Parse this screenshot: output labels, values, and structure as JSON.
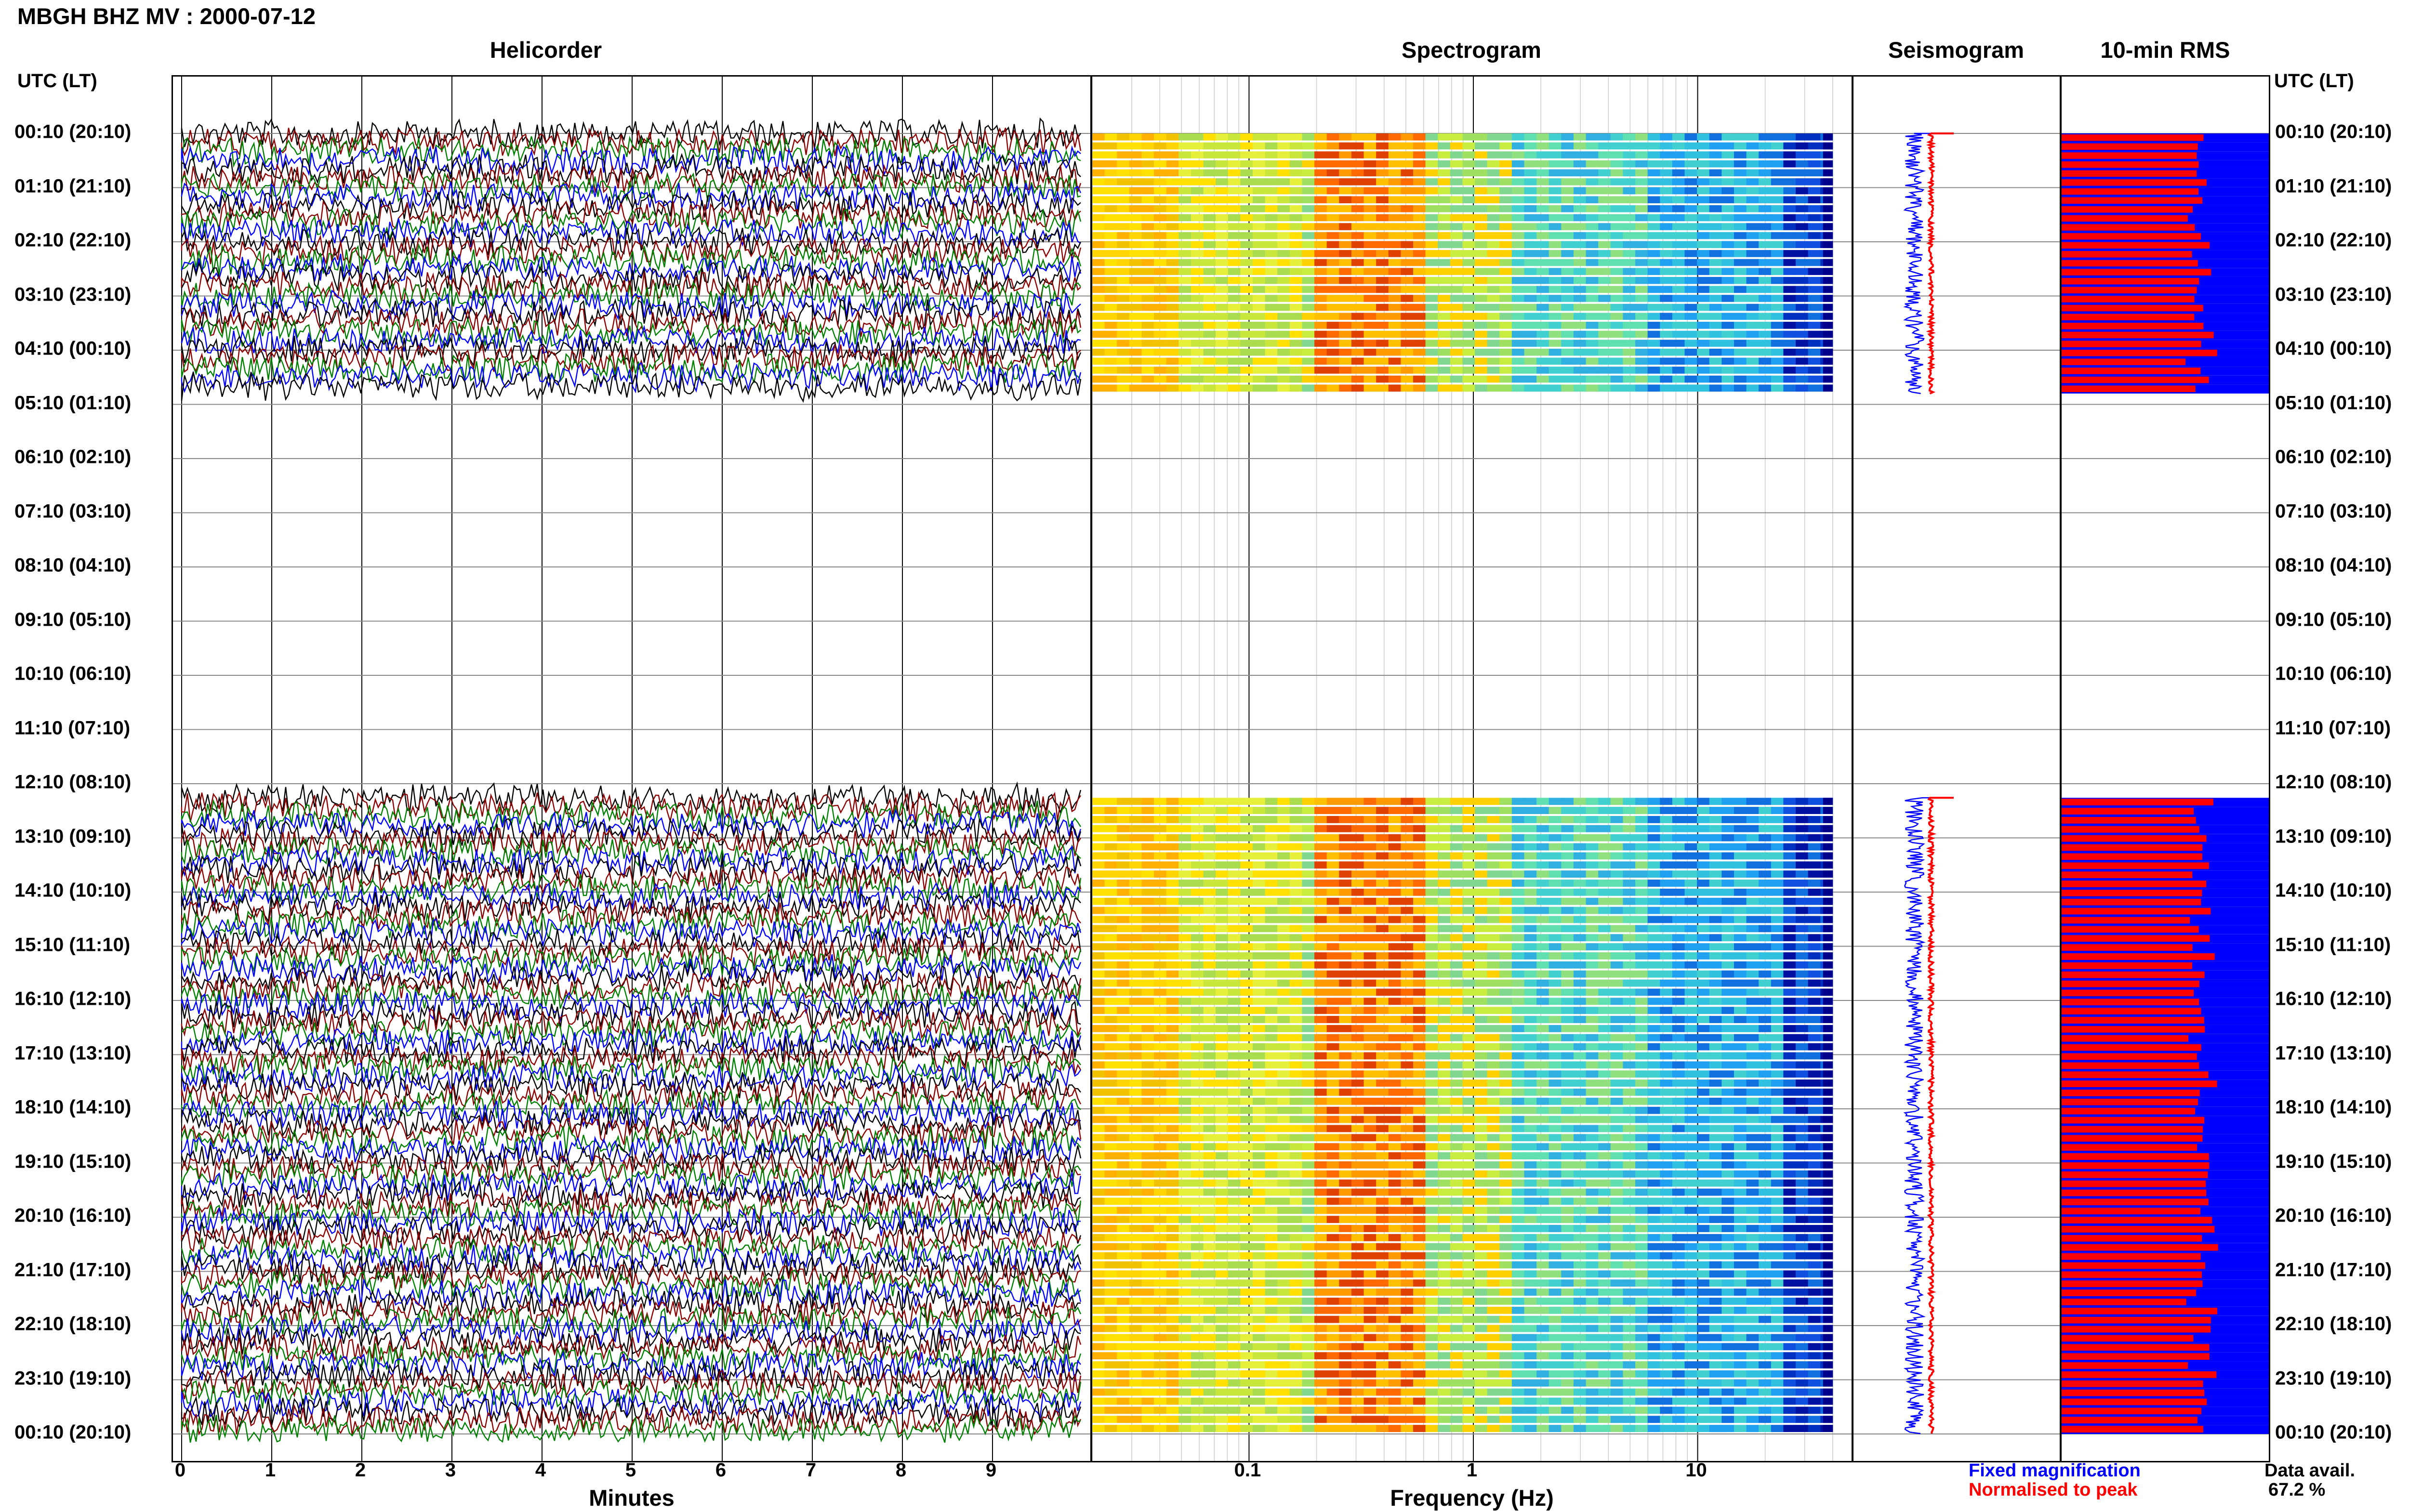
{
  "header": {
    "title": "MBGH BHZ MV : 2000-07-12"
  },
  "columns": {
    "helicorder": "Helicorder",
    "spectrogram": "Spectrogram",
    "seismogram": "Seismogram",
    "rms": "10-min RMS"
  },
  "utc_header": "UTC (LT)",
  "chart_data": {
    "type": "heatmap",
    "title": "MBGH BHZ MV : 2000-07-12",
    "time_labels": [
      "00:10 (20:10)",
      "01:10 (21:10)",
      "02:10 (22:10)",
      "03:10 (23:10)",
      "04:10 (00:10)",
      "05:10 (01:10)",
      "06:10 (02:10)",
      "07:10 (03:10)",
      "08:10 (04:10)",
      "09:10 (05:10)",
      "10:10 (06:10)",
      "11:10 (07:10)",
      "12:10 (08:10)",
      "13:10 (09:10)",
      "14:10 (10:10)",
      "15:10 (11:10)",
      "16:10 (12:10)",
      "17:10 (13:10)",
      "18:10 (14:10)",
      "19:10 (15:10)",
      "20:10 (16:10)",
      "21:10 (17:10)",
      "22:10 (18:10)",
      "23:10 (19:10)",
      "00:10 (20:10)"
    ],
    "data_gap_hours": [
      4.8,
      12.2
    ],
    "helicorder": {
      "xlabel": "Minutes",
      "xticks": [
        0,
        1,
        2,
        3,
        4,
        5,
        6,
        7,
        8,
        9
      ],
      "xlim": [
        0,
        10
      ],
      "trace_colors": [
        "#000000",
        "#8b0000",
        "#008000",
        "#0000ff"
      ]
    },
    "spectrogram": {
      "xlabel": "Frequency (Hz)",
      "xscale": "log",
      "xticks": [
        0.1,
        1,
        10
      ],
      "xtick_labels": [
        "0.1",
        "1",
        "10"
      ],
      "xlim": [
        0.02,
        50
      ],
      "peak_band_hz": [
        0.2,
        0.6
      ]
    },
    "seismogram": {
      "legend": [
        {
          "name": "Fixed magnification",
          "color": "#0000ff"
        },
        {
          "name": "Normalised to peak",
          "color": "#ff0000"
        }
      ]
    },
    "rms": {
      "label": "10-min RMS",
      "colors": {
        "fixed": "#0000ff",
        "normalised": "#ff0000"
      }
    },
    "data_availability": {
      "label": "Data avail.",
      "value": "67.2 %"
    }
  }
}
